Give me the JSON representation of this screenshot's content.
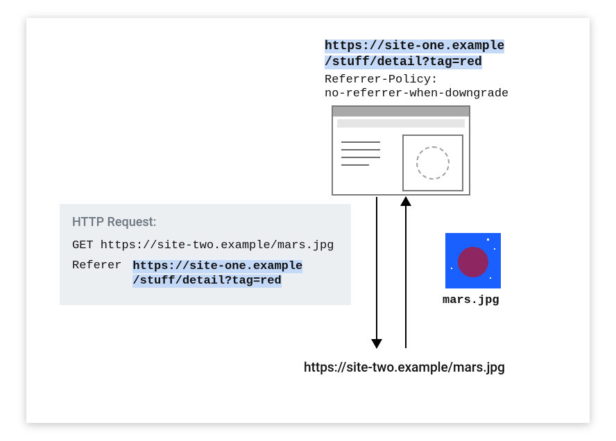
{
  "top_url_line1": "https://site-one.example",
  "top_url_line2": "/stuff/detail?tag=red",
  "policy_label": "Referrer-Policy:",
  "policy_value": "no-referrer-when-downgrade",
  "request": {
    "title": "HTTP Request:",
    "method_line": "GET https://site-two.example/mars.jpg",
    "referer_label": "Referer",
    "referer_url_line1": "https://site-one.example",
    "referer_url_line2": "/stuff/detail?tag=red"
  },
  "mars_label": "mars.jpg",
  "bottom_url": "https://site-two.example/mars.jpg"
}
